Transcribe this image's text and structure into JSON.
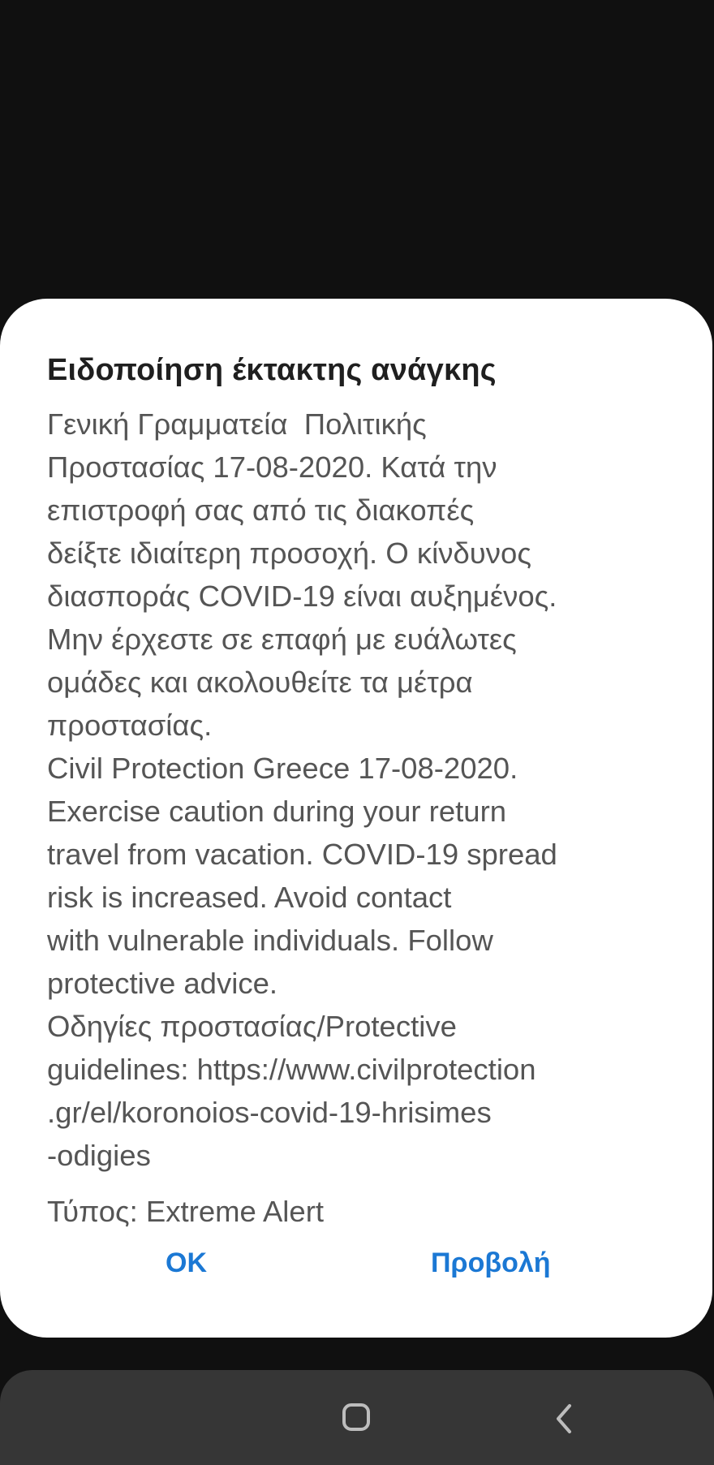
{
  "alert": {
    "title": "Ειδοποίηση έκτακτης ανάγκης",
    "message_lines": [
      "Γενική Γραμματεία  Πολιτικής",
      "Προστασίας 17-08-2020. Κατά την",
      "επιστροφή σας από τις διακοπές",
      "δείξτε ιδιαίτερη προσοχή. Ο κίνδυνος",
      "διασποράς COVID-19 είναι αυξημένος.",
      "Μην έρχεστε σε επαφή με ευάλωτες",
      "ομάδες και ακολουθείτε τα μέτρα",
      "προστασίας.",
      "Civil Protection Greece 17-08-2020.",
      "Exercise caution during your return",
      "travel from vacation. COVID-19 spread",
      "risk is increased. Avoid contact",
      "with vulnerable individuals. Follow",
      "protective advice.",
      "Οδηγίες προστασίας/Protective",
      "guidelines: https://www.civilprotection",
      ".gr/el/koronoios-covid-19-hrisimes",
      "-odigies"
    ],
    "type_line": "Τύπος: Extreme Alert",
    "ok_label": "OK",
    "view_label": "Προβολή"
  },
  "nav": {
    "home_icon": "home-icon",
    "back_icon": "back-icon"
  },
  "colors": {
    "accent": "#1b78d4",
    "background": "#101010",
    "dialog": "#ffffff",
    "nav_bar": "#363636"
  }
}
